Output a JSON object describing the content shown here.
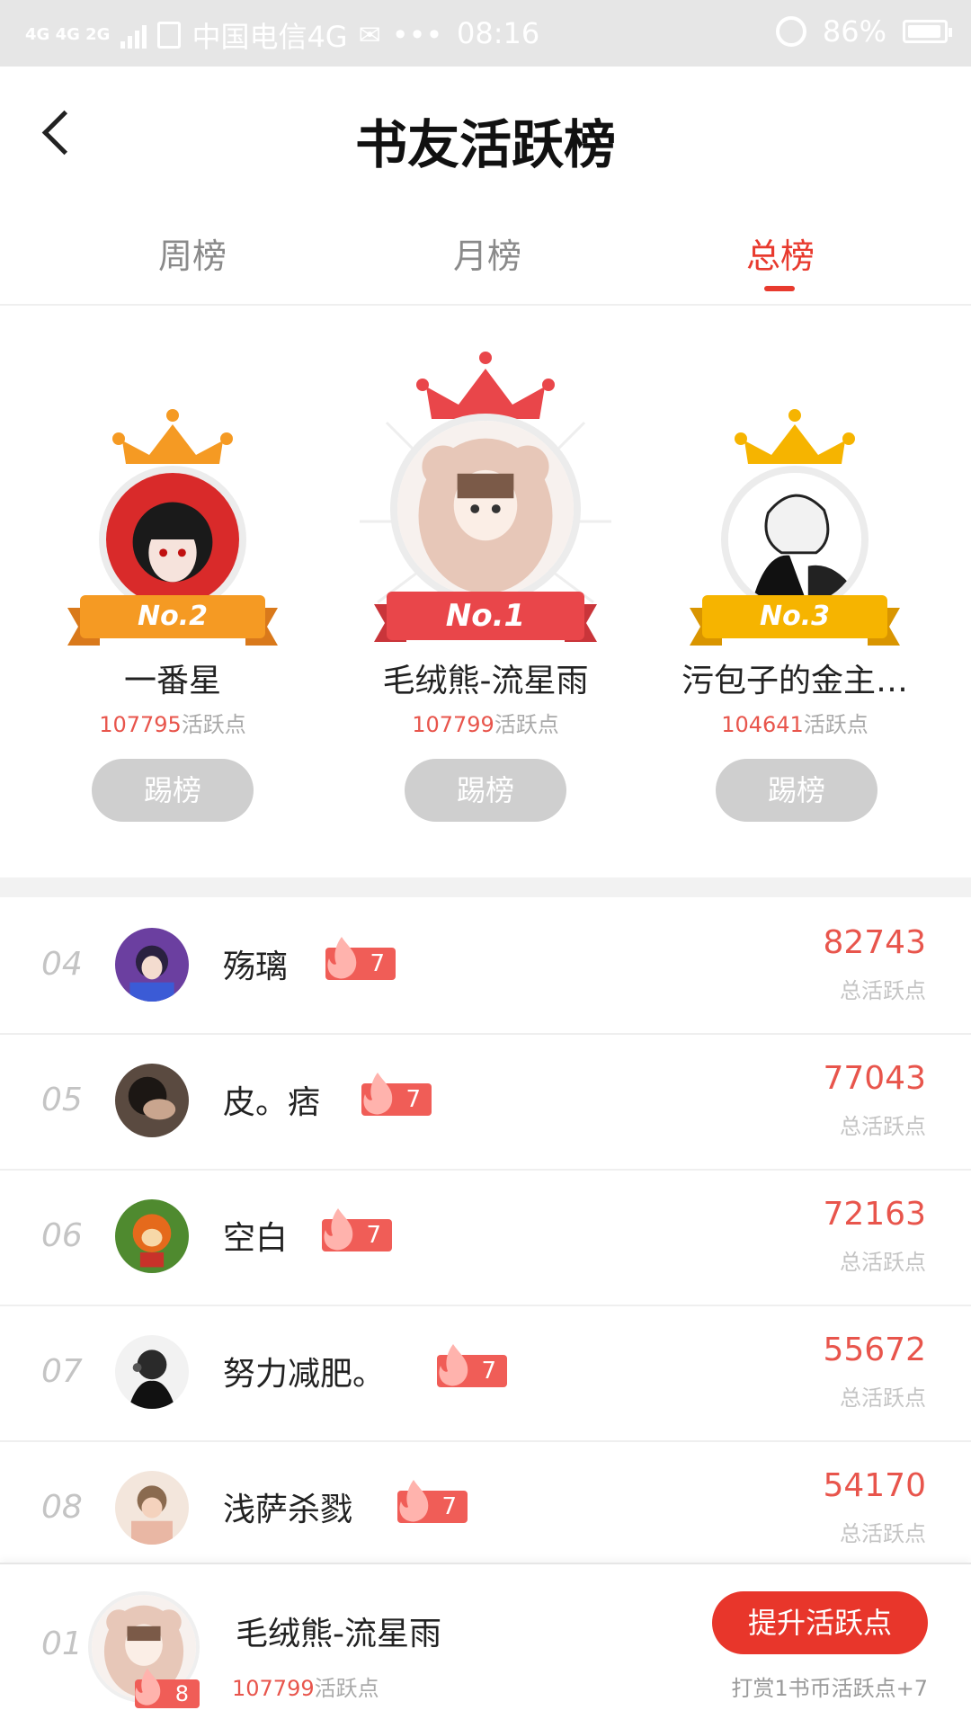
{
  "status_bar": {
    "network": "4G 4G 2G",
    "carrier": "中国电信4G",
    "dots": "•••",
    "time": "08:16",
    "battery": "86%"
  },
  "header": {
    "title": "书友活跃榜"
  },
  "tabs": [
    {
      "label": "周榜",
      "active": false
    },
    {
      "label": "月榜",
      "active": false
    },
    {
      "label": "总榜",
      "active": true
    }
  ],
  "podium": [
    {
      "rank_label": "No.2",
      "name": "一番星",
      "points": "107795",
      "points_suffix": "活跃点",
      "button": "踢榜"
    },
    {
      "rank_label": "No.1",
      "name": "毛绒熊-流星雨",
      "points": "107799",
      "points_suffix": "活跃点",
      "button": "踢榜"
    },
    {
      "rank_label": "No.3",
      "name": "污包子的金主…",
      "points": "104641",
      "points_suffix": "活跃点",
      "button": "踢榜"
    }
  ],
  "list": [
    {
      "rank": "04",
      "name": "殇璃",
      "level": "7",
      "points": "82743",
      "label": "总活跃点"
    },
    {
      "rank": "05",
      "name": "皮。痞",
      "level": "7",
      "points": "77043",
      "label": "总活跃点"
    },
    {
      "rank": "06",
      "name": "空白",
      "level": "7",
      "points": "72163",
      "label": "总活跃点"
    },
    {
      "rank": "07",
      "name": "努力减肥。",
      "level": "7",
      "points": "55672",
      "label": "总活跃点"
    },
    {
      "rank": "08",
      "name": "浅萨杀戮",
      "level": "7",
      "points": "54170",
      "label": "总活跃点"
    }
  ],
  "bottom_bar": {
    "rank": "01",
    "name": "毛绒熊-流星雨",
    "level": "8",
    "points": "107799",
    "points_suffix": "活跃点",
    "button": "提升活跃点",
    "note": "打赏1书币活跃点+7"
  },
  "colors": {
    "accent": "#e83a2e",
    "gold": "#f6b400",
    "silver_orange": "#f59a23",
    "first_red": "#e9464a",
    "button_gray": "#cfcfcf"
  }
}
